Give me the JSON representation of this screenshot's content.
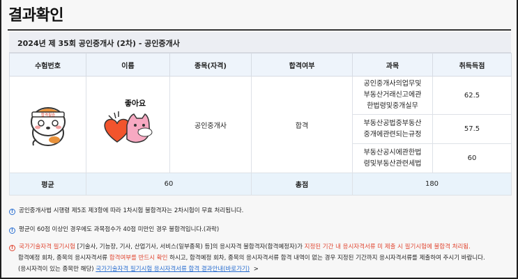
{
  "page": {
    "title": "결과확인"
  },
  "exam": {
    "header": "2024년 제 35회 공인중개사 (2차) - 공인중개사"
  },
  "table": {
    "headers": [
      "수험번호",
      "이름",
      "종목(자격)",
      "합격여부",
      "과목",
      "취득득점"
    ],
    "sticker_text": "좋아요",
    "headband_text": "합격필승",
    "category": "공인중개사",
    "pass_status": "합격",
    "subjects": [
      {
        "line1": "공인중개사의업무및",
        "line2": "부동산거래신고에관",
        "line3": "한법령및중개실무",
        "score": "62.5"
      },
      {
        "line1": "부동산공법중부동산",
        "line2": "중개에관련되는규정",
        "line3": "",
        "score": "57.5"
      },
      {
        "line1": "부동산공시에관한법",
        "line2": "령및부동산관련세법",
        "line3": "",
        "score": "60"
      }
    ],
    "avg_label": "평균",
    "avg_value": "60",
    "total_label": "총점",
    "total_value": "180"
  },
  "notes": {
    "n1": "공인중개사법 시행령 제5조 제3항에 따라 1차시험 불합격자는 2차시험이 무효 처리됩니다.",
    "n2": "평균이 60점 이상인 경우에도 과목점수가 40점 미만인 경우 불합격입니다.(과락)",
    "n3_red1": "국가기술자격 필기시험",
    "n3_a": " [기술사, 기능장, 기사, 산업기사, 서비스(일부종목) 등]의 응시자격 불합격자(합격예정자)가 ",
    "n3_red2": "지정된 기간 내 응시자격서류 미 제출 시 필기시험에 불합격 처리됨.",
    "n4_a": "합격예정 회차, 종목의 응시자격서류 ",
    "n4_red": "합격여부를 반드시 확인",
    "n4_b": " 하시고, 합격예정 회차, 종목의 응시자격서류 합격 내역이 없는 경우 지정된 기간까지 응시자격서류를 제출하여 주시기 바랍니다.",
    "n5_a": "(응시자격이 있는 종목만 해당) ",
    "n5_link": "국가기술자격 필기시험 응시자격서류 합격 결과안내(바로가기)",
    "n5_arrow": ">"
  },
  "colors": {
    "accent": "#2a6fd1",
    "warning": "#e0442f",
    "header_bg": "#eef4fb",
    "avg_bg": "#e9f3fb"
  }
}
